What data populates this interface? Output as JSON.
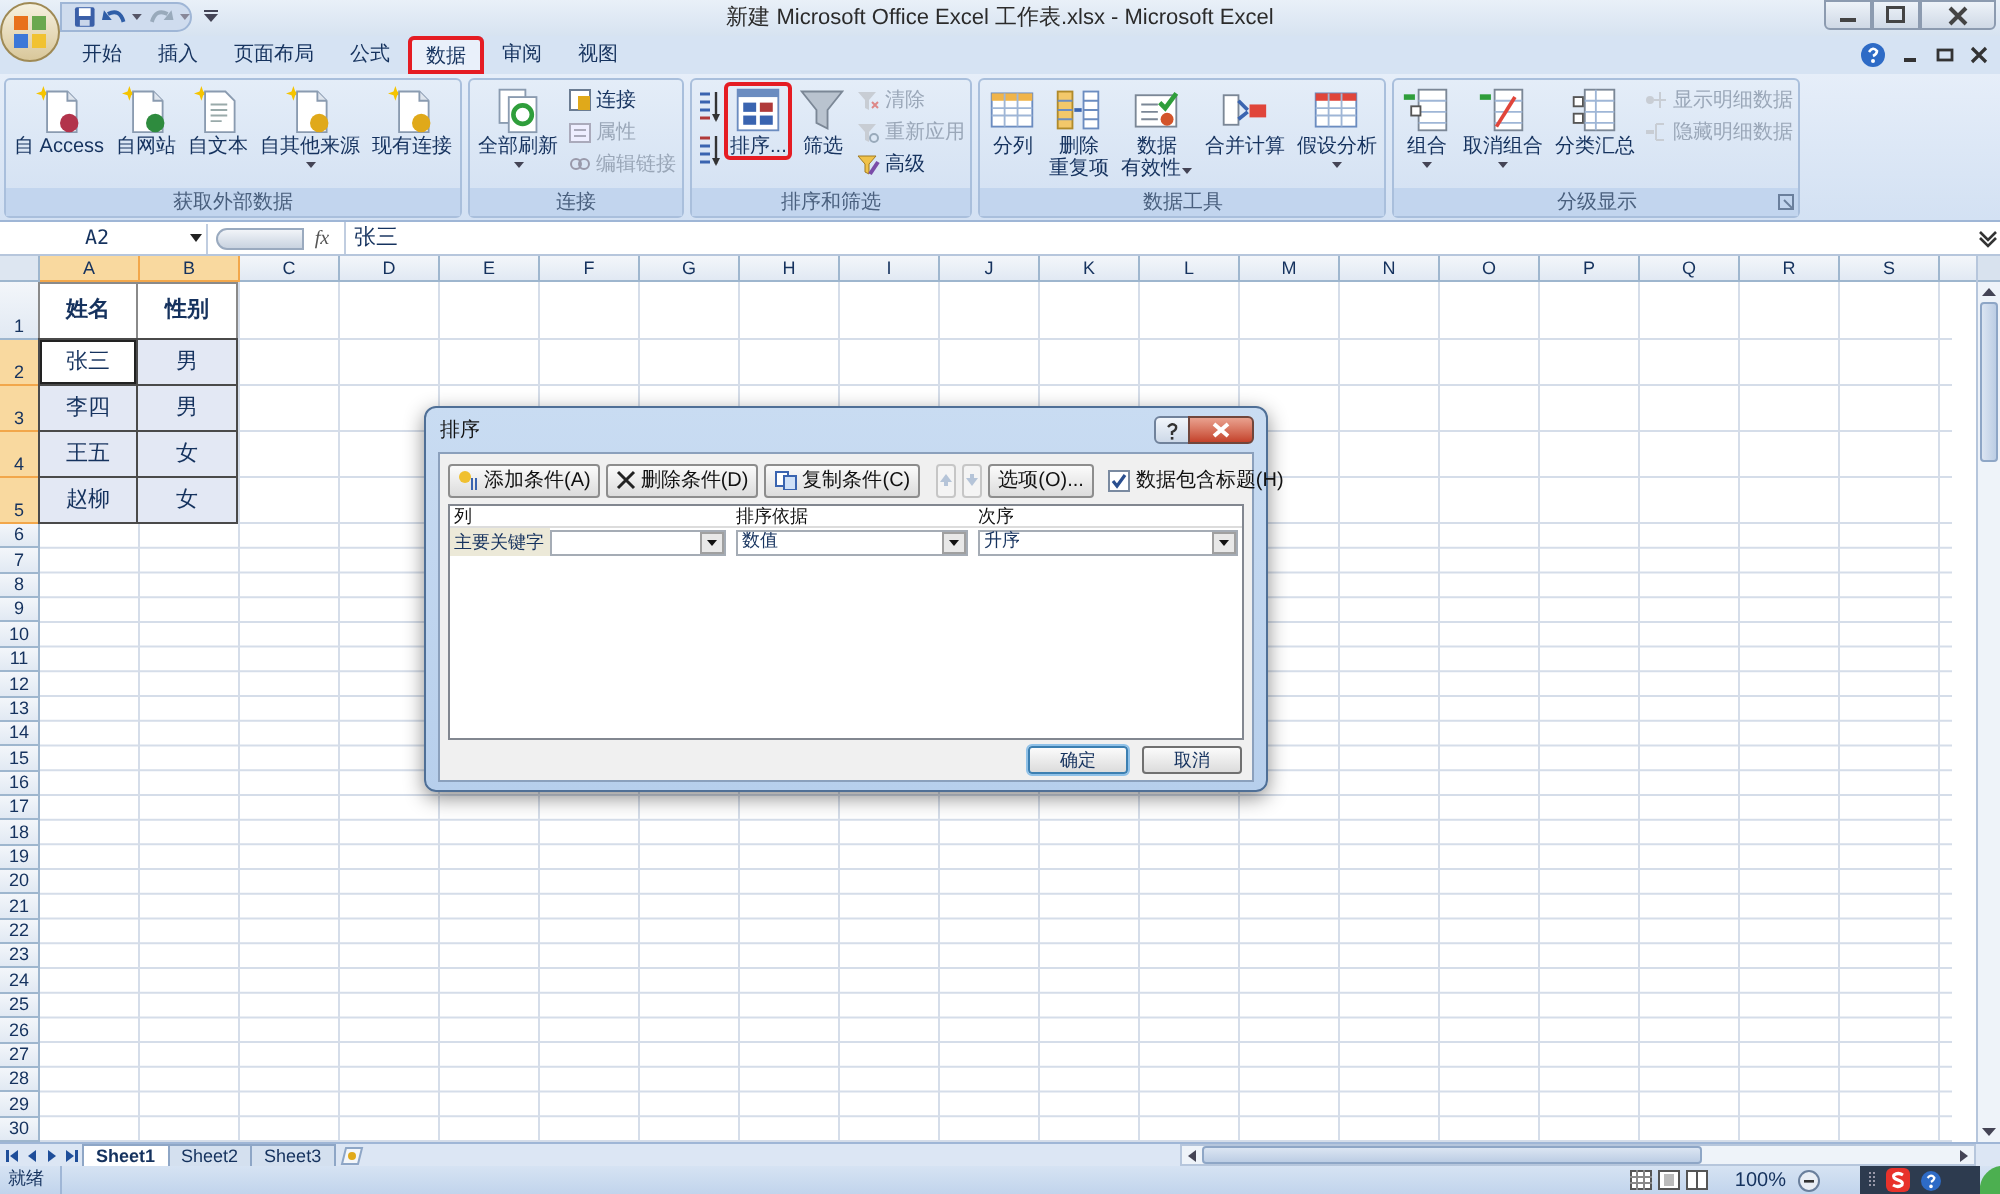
{
  "window": {
    "title": "新建 Microsoft Office Excel 工作表.xlsx - Microsoft Excel"
  },
  "ribbon_tabs": [
    {
      "label": "开始",
      "selected": false,
      "highlighted": false
    },
    {
      "label": "插入",
      "selected": false,
      "highlighted": false
    },
    {
      "label": "页面布局",
      "selected": false,
      "highlighted": false
    },
    {
      "label": "公式",
      "selected": false,
      "highlighted": false
    },
    {
      "label": "数据",
      "selected": true,
      "highlighted": true
    },
    {
      "label": "审阅",
      "selected": false,
      "highlighted": false
    },
    {
      "label": "视图",
      "selected": false,
      "highlighted": false
    }
  ],
  "ribbon_groups": [
    {
      "label": "获取外部数据",
      "dialog_launcher": false,
      "commands": [
        {
          "kind": "large",
          "lines": [
            "自 Access"
          ],
          "disabled": false,
          "highlighted": false,
          "dropdown": false
        },
        {
          "kind": "large",
          "lines": [
            "自网站"
          ],
          "disabled": false,
          "highlighted": false,
          "dropdown": false
        },
        {
          "kind": "large",
          "lines": [
            "自文本"
          ],
          "disabled": false,
          "highlighted": false,
          "dropdown": false
        },
        {
          "kind": "large",
          "lines": [
            "自其他来源"
          ],
          "disabled": false,
          "highlighted": false,
          "dropdown": true
        },
        {
          "kind": "large",
          "lines": [
            "现有连接"
          ],
          "disabled": false,
          "highlighted": false,
          "dropdown": false
        }
      ]
    },
    {
      "label": "连接",
      "dialog_launcher": false,
      "commands": [
        {
          "kind": "large",
          "lines": [
            "全部刷新"
          ],
          "disabled": false,
          "highlighted": false,
          "dropdown": true
        },
        {
          "kind": "small",
          "lines": [
            "连接"
          ],
          "disabled": false,
          "highlighted": false,
          "dropdown": false
        },
        {
          "kind": "small",
          "lines": [
            "属性"
          ],
          "disabled": true,
          "highlighted": false,
          "dropdown": false
        },
        {
          "kind": "small",
          "lines": [
            "编辑链接"
          ],
          "disabled": true,
          "highlighted": false,
          "dropdown": false
        }
      ]
    },
    {
      "label": "排序和筛选",
      "dialog_launcher": false,
      "commands": [
        {
          "kind": "icon",
          "disabled": false,
          "highlighted": false,
          "dropdown": false
        },
        {
          "kind": "icon",
          "disabled": false,
          "highlighted": false,
          "dropdown": false
        },
        {
          "kind": "large",
          "lines": [
            "排序..."
          ],
          "disabled": false,
          "highlighted": true,
          "dropdown": false
        },
        {
          "kind": "large",
          "lines": [
            "筛选"
          ],
          "disabled": false,
          "highlighted": false,
          "dropdown": false
        },
        {
          "kind": "small",
          "lines": [
            "清除"
          ],
          "disabled": true,
          "highlighted": false,
          "dropdown": false
        },
        {
          "kind": "small",
          "lines": [
            "重新应用"
          ],
          "disabled": true,
          "highlighted": false,
          "dropdown": false
        },
        {
          "kind": "small",
          "lines": [
            "高级"
          ],
          "disabled": false,
          "highlighted": false,
          "dropdown": false
        }
      ]
    },
    {
      "label": "数据工具",
      "dialog_launcher": false,
      "commands": [
        {
          "kind": "large",
          "lines": [
            "分列"
          ],
          "disabled": false,
          "highlighted": false,
          "dropdown": false
        },
        {
          "kind": "large",
          "lines": [
            "删除",
            "重复项"
          ],
          "disabled": false,
          "highlighted": false,
          "dropdown": false
        },
        {
          "kind": "large",
          "lines": [
            "数据",
            "有效性"
          ],
          "disabled": false,
          "highlighted": false,
          "dropdown": true
        },
        {
          "kind": "large",
          "lines": [
            "合并计算"
          ],
          "disabled": false,
          "highlighted": false,
          "dropdown": false
        },
        {
          "kind": "large",
          "lines": [
            "假设分析"
          ],
          "disabled": false,
          "highlighted": false,
          "dropdown": true
        }
      ]
    },
    {
      "label": "分级显示",
      "dialog_launcher": true,
      "commands": [
        {
          "kind": "large",
          "lines": [
            "组合"
          ],
          "disabled": false,
          "highlighted": false,
          "dropdown": true
        },
        {
          "kind": "large",
          "lines": [
            "取消组合"
          ],
          "disabled": false,
          "highlighted": false,
          "dropdown": true
        },
        {
          "kind": "large",
          "lines": [
            "分类汇总"
          ],
          "disabled": false,
          "highlighted": false,
          "dropdown": false
        },
        {
          "kind": "small",
          "lines": [
            "显示明细数据"
          ],
          "disabled": true,
          "highlighted": false,
          "dropdown": false
        },
        {
          "kind": "small",
          "lines": [
            "隐藏明细数据"
          ],
          "disabled": true,
          "highlighted": false,
          "dropdown": false
        }
      ]
    }
  ],
  "formula_bar": {
    "name_box": "A2",
    "function_button": "fx",
    "value": "张三"
  },
  "sheet": {
    "columns": [
      {
        "label": "A",
        "selected": true
      },
      {
        "label": "B",
        "selected": true
      },
      {
        "label": "C",
        "selected": false
      },
      {
        "label": "D",
        "selected": false
      },
      {
        "label": "E",
        "selected": false
      },
      {
        "label": "F",
        "selected": false
      },
      {
        "label": "G",
        "selected": false
      },
      {
        "label": "H",
        "selected": false
      },
      {
        "label": "I",
        "selected": false
      },
      {
        "label": "J",
        "selected": false
      },
      {
        "label": "K",
        "selected": false
      },
      {
        "label": "L",
        "selected": false
      },
      {
        "label": "M",
        "selected": false
      },
      {
        "label": "N",
        "selected": false
      },
      {
        "label": "O",
        "selected": false
      },
      {
        "label": "P",
        "selected": false
      },
      {
        "label": "Q",
        "selected": false
      },
      {
        "label": "R",
        "selected": false
      },
      {
        "label": "S",
        "selected": false
      }
    ],
    "rows": [
      {
        "label": "1",
        "selected": false,
        "cells": [
          {
            "text": "姓名",
            "selected": false,
            "active": false
          },
          {
            "text": "性别",
            "selected": false,
            "active": false
          }
        ]
      },
      {
        "label": "2",
        "selected": true,
        "cells": [
          {
            "text": "张三",
            "selected": true,
            "active": true
          },
          {
            "text": "男",
            "selected": true,
            "active": false
          }
        ]
      },
      {
        "label": "3",
        "selected": true,
        "cells": [
          {
            "text": "李四",
            "selected": true,
            "active": false
          },
          {
            "text": "男",
            "selected": true,
            "active": false
          }
        ]
      },
      {
        "label": "4",
        "selected": true,
        "cells": [
          {
            "text": "王五",
            "selected": true,
            "active": false
          },
          {
            "text": "女",
            "selected": true,
            "active": false
          }
        ]
      },
      {
        "label": "5",
        "selected": true,
        "cells": [
          {
            "text": "赵柳",
            "selected": true,
            "active": false
          },
          {
            "text": "女",
            "selected": true,
            "active": false
          }
        ]
      },
      {
        "label": "6",
        "selected": false
      },
      {
        "label": "7",
        "selected": false
      },
      {
        "label": "8",
        "selected": false
      },
      {
        "label": "9",
        "selected": false
      },
      {
        "label": "10",
        "selected": false
      },
      {
        "label": "11",
        "selected": false
      },
      {
        "label": "12",
        "selected": false
      },
      {
        "label": "13",
        "selected": false
      },
      {
        "label": "14",
        "selected": false
      },
      {
        "label": "15",
        "selected": false
      },
      {
        "label": "16",
        "selected": false
      },
      {
        "label": "17",
        "selected": false
      },
      {
        "label": "18",
        "selected": false
      },
      {
        "label": "19",
        "selected": false
      },
      {
        "label": "20",
        "selected": false
      },
      {
        "label": "21",
        "selected": false
      },
      {
        "label": "22",
        "selected": false
      },
      {
        "label": "23",
        "selected": false
      },
      {
        "label": "24",
        "selected": false
      },
      {
        "label": "25",
        "selected": false
      },
      {
        "label": "26",
        "selected": false
      },
      {
        "label": "27",
        "selected": false
      },
      {
        "label": "28",
        "selected": false
      },
      {
        "label": "29",
        "selected": false
      },
      {
        "label": "30",
        "selected": false
      }
    ]
  },
  "sheet_tabs": [
    {
      "label": "Sheet1",
      "selected": true
    },
    {
      "label": "Sheet2",
      "selected": false
    },
    {
      "label": "Sheet3",
      "selected": false
    }
  ],
  "status_bar": {
    "text": "就绪",
    "zoom": "100%"
  },
  "sort_dialog": {
    "title": "排序",
    "toolbar": [
      {
        "kind": "button",
        "label": "添加条件(A)",
        "disabled": false
      },
      {
        "kind": "button",
        "label": "删除条件(D)",
        "disabled": false
      },
      {
        "kind": "button",
        "label": "复制条件(C)",
        "disabled": false
      },
      {
        "kind": "up",
        "disabled": true
      },
      {
        "kind": "down",
        "disabled": true
      },
      {
        "kind": "button",
        "label": "选项(O)...",
        "disabled": false
      }
    ],
    "header_checkbox": {
      "label": "数据包含标题(H)",
      "checked": true
    },
    "columns": [
      "列",
      "排序依据",
      "次序"
    ],
    "rows": [
      {
        "label": "主要关键字",
        "column": {},
        "sort_on": {
          "value": "数值"
        },
        "order": {
          "value": "升序"
        }
      }
    ],
    "buttons": [
      {
        "label": "确定",
        "default": true
      },
      {
        "label": "取消",
        "default": false
      }
    ]
  }
}
